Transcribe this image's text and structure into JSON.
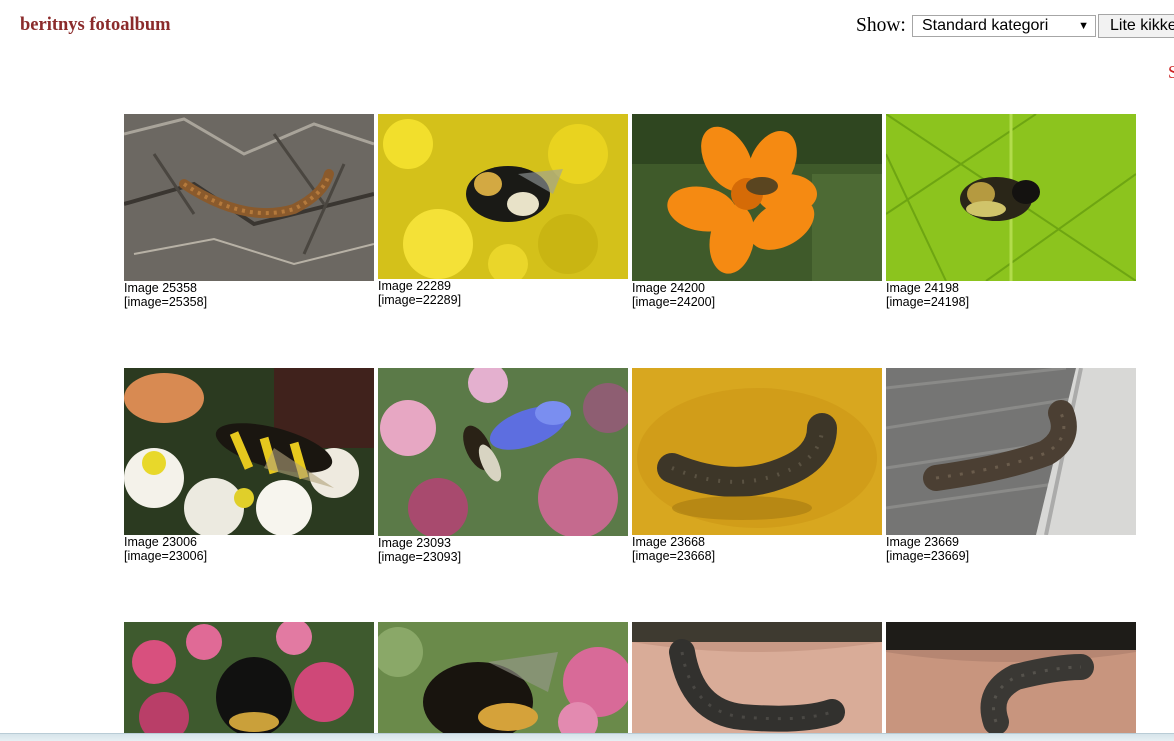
{
  "header": {
    "site_title": "beritnys fotoalbum",
    "show_label": "Show:",
    "select_value": "Standard kategori",
    "button_label": "Lite kikke",
    "edge_text": "S"
  },
  "gallery": [
    {
      "title": "Image 25358",
      "code": "[image=25358]",
      "subject": "centipede"
    },
    {
      "title": "Image 22289",
      "code": "[image=22289]",
      "subject": "bumblebee-on-yellow-flowers"
    },
    {
      "title": "Image 24200",
      "code": "[image=24200]",
      "subject": "bee-on-orange-flower"
    },
    {
      "title": "Image 24198",
      "code": "[image=24198]",
      "subject": "bee-on-green-leaf"
    },
    {
      "title": "Image 23006",
      "code": "[image=23006]",
      "subject": "wasp-on-white-flowers"
    },
    {
      "title": "Image 23093",
      "code": "[image=23093]",
      "subject": "hoverfly-on-blue-flower"
    },
    {
      "title": "Image 23668",
      "code": "[image=23668]",
      "subject": "caterpillar-on-yellow"
    },
    {
      "title": "Image 23669",
      "code": "[image=23669]",
      "subject": "caterpillar-on-wood"
    },
    {
      "title": "",
      "code": "",
      "subject": "bumblebee-on-pink-flowers"
    },
    {
      "title": "",
      "code": "",
      "subject": "bumblebee-back"
    },
    {
      "title": "",
      "code": "",
      "subject": "caterpillar-on-hand"
    },
    {
      "title": "",
      "code": "",
      "subject": "caterpillar-on-palm"
    }
  ],
  "colors": {
    "title": "#8b2b2b",
    "edge_text": "#cc2222"
  }
}
